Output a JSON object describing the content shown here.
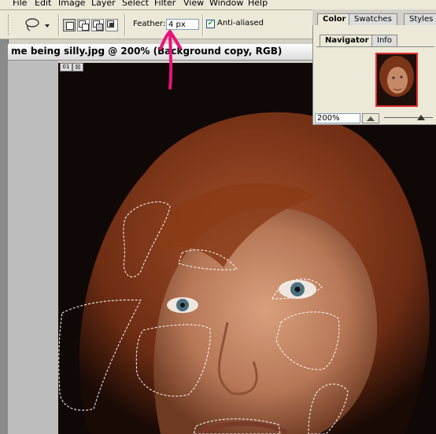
{
  "menu": [
    "File",
    "Edit",
    "Image",
    "Layer",
    "Select",
    "Filter",
    "View",
    "Window",
    "Help"
  ],
  "options": {
    "feather_label": "Feather:",
    "feather_value": "4 px",
    "antialias_label": "Anti-aliased",
    "antialias_checked": true
  },
  "document": {
    "title": "me being silly.jpg @ 200% (Background copy, RGB)",
    "badge_1": "01",
    "badge_2": "☒"
  },
  "palette": {
    "top_tabs": [
      "Color",
      "Swatches",
      "Styles"
    ],
    "tabs": [
      "Navigator",
      "Info"
    ],
    "zoom": "200%"
  },
  "colors": {
    "annotation": "#e8137a",
    "menubar": "#ece9d8",
    "canvas_bg": "#100806",
    "nav_frame": "#e0302a"
  }
}
